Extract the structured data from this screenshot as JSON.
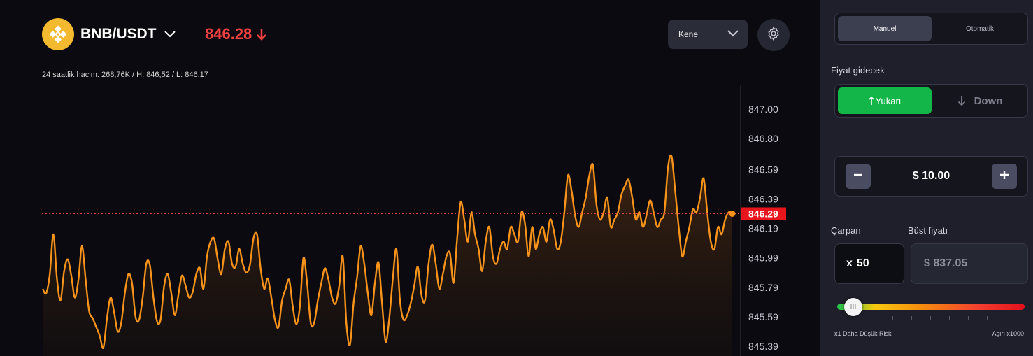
{
  "header": {
    "pair": "BNB/USDT",
    "coin_icon": "bnb-logo-icon",
    "price": "846.28",
    "price_color": "#f0403f",
    "volume_line": "24 saatlik hacim: 268,76K / H: 846,52 / L: 846,17",
    "interval_select": "Kene"
  },
  "chart_data": {
    "type": "area",
    "yaxis_ticks": [
      "847.00",
      "846.80",
      "846.59",
      "846.39",
      "846.19",
      "845.99",
      "845.79",
      "845.59",
      "845.39"
    ],
    "ylim": [
      845.39,
      847.0
    ],
    "current_price": 846.29,
    "current_price_label": "846.29",
    "line_color": "#f7931a",
    "marker_color": "#e84142",
    "y": [
      845.78,
      845.75,
      845.88,
      846.15,
      845.85,
      845.7,
      845.9,
      845.98,
      845.87,
      845.72,
      845.84,
      846.07,
      845.85,
      845.63,
      845.58,
      845.52,
      845.46,
      845.38,
      845.58,
      845.72,
      845.62,
      845.49,
      845.55,
      845.75,
      845.88,
      845.82,
      845.59,
      845.57,
      845.72,
      845.95,
      845.94,
      845.72,
      845.56,
      845.57,
      845.8,
      845.88,
      845.75,
      845.6,
      845.74,
      845.87,
      845.8,
      845.72,
      845.76,
      845.88,
      845.92,
      845.78,
      846.0,
      846.1,
      846.12,
      845.98,
      845.88,
      846.05,
      846.1,
      845.95,
      845.93,
      846.05,
      845.95,
      845.89,
      845.94,
      846.12,
      846.15,
      845.92,
      845.78,
      845.85,
      845.72,
      845.57,
      845.52,
      845.7,
      845.78,
      845.84,
      845.66,
      845.54,
      845.66,
      845.99,
      845.82,
      845.55,
      845.55,
      845.7,
      845.82,
      845.92,
      845.84,
      845.72,
      845.68,
      845.8,
      846.0,
      845.55,
      845.4,
      845.68,
      845.86,
      846.07,
      845.95,
      845.75,
      845.6,
      845.82,
      845.96,
      845.68,
      845.42,
      845.58,
      845.85,
      846.05,
      845.7,
      845.57,
      845.6,
      845.68,
      845.8,
      845.93,
      845.74,
      845.7,
      845.95,
      846.08,
      845.95,
      845.78,
      845.88,
      846.0,
      846.02,
      845.82,
      846.12,
      846.37,
      846.25,
      846.1,
      846.3,
      846.15,
      846.05,
      845.9,
      846.1,
      846.2,
      846.0,
      845.95,
      846.05,
      846.1,
      846.05,
      846.2,
      846.15,
      846.1,
      846.3,
      846.22,
      846.0,
      846.2,
      846.05,
      846.15,
      846.2,
      846.1,
      846.25,
      846.18,
      846.05,
      846.1,
      846.3,
      846.55,
      846.45,
      846.28,
      846.2,
      846.3,
      846.4,
      846.55,
      846.62,
      846.35,
      846.25,
      846.3,
      846.4,
      846.2,
      846.25,
      846.3,
      846.42,
      846.48,
      846.52,
      846.4,
      846.25,
      846.3,
      846.2,
      846.28,
      846.38,
      846.3,
      846.2,
      846.25,
      846.3,
      846.6,
      846.68,
      846.45,
      846.2,
      846.0,
      846.1,
      846.2,
      846.32,
      846.3,
      846.4,
      846.53,
      846.3,
      846.1,
      846.05,
      846.2,
      846.15,
      846.25,
      846.3,
      846.29
    ]
  },
  "panel": {
    "mode_tabs": [
      {
        "label": "Manuel",
        "active": true
      },
      {
        "label": "Otomatik",
        "active": false
      }
    ],
    "direction_label": "Fiyat gidecek",
    "up_button": "Yukarı",
    "down_button": "Down",
    "up_color": "#13b749",
    "amount": "$ 10.00",
    "multiplier_label": "Çarpan",
    "bust_label": "Büst fiyatı",
    "multiplier_prefix": "x",
    "multiplier_value": "50",
    "bust_price": "$ 837.05",
    "risk_min_label": "x1 Daha Düşük Risk",
    "risk_max_label": "Aşırı x1000"
  }
}
